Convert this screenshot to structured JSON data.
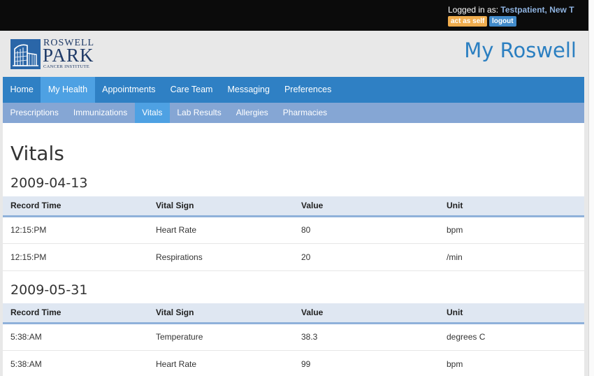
{
  "header": {
    "login_prefix": "Logged in as: ",
    "user_name": "Testpatient, New T",
    "act_as_self_label": "act as self",
    "logout_label": "logout",
    "app_title": "My Roswell"
  },
  "logo": {
    "line1": "ROSWELL",
    "line2": "PARK",
    "line3": "CANCER INSTITUTE"
  },
  "colors": {
    "top_bar": "#0b0b0b",
    "primary_nav": "#2f80c4",
    "secondary_nav": "#85a6d4",
    "active_item": "#4ea1e3",
    "title_blue": "#2b7fc1",
    "act_button": "#f0ad4e",
    "logout_button": "#428bca"
  },
  "primary_nav": [
    {
      "label": "Home",
      "active": false
    },
    {
      "label": "My Health",
      "active": true
    },
    {
      "label": "Appointments",
      "active": false
    },
    {
      "label": "Care Team",
      "active": false
    },
    {
      "label": "Messaging",
      "active": false
    },
    {
      "label": "Preferences",
      "active": false
    }
  ],
  "secondary_nav": [
    {
      "label": "Prescriptions",
      "active": false
    },
    {
      "label": "Immunizations",
      "active": false
    },
    {
      "label": "Vitals",
      "active": true
    },
    {
      "label": "Lab Results",
      "active": false
    },
    {
      "label": "Allergies",
      "active": false
    },
    {
      "label": "Pharmacies",
      "active": false
    }
  ],
  "page": {
    "title": "Vitals",
    "columns": [
      "Record Time",
      "Vital Sign",
      "Value",
      "Unit"
    ],
    "sections": [
      {
        "date": "2009-04-13",
        "rows": [
          [
            "12:15:PM",
            "Heart Rate",
            "80",
            "bpm"
          ],
          [
            "12:15:PM",
            "Respirations",
            "20",
            "/min"
          ]
        ]
      },
      {
        "date": "2009-05-31",
        "rows": [
          [
            "5:38:AM",
            "Temperature",
            "38.3",
            "degrees C"
          ],
          [
            "5:38:AM",
            "Heart Rate",
            "99",
            "bpm"
          ]
        ]
      }
    ]
  }
}
